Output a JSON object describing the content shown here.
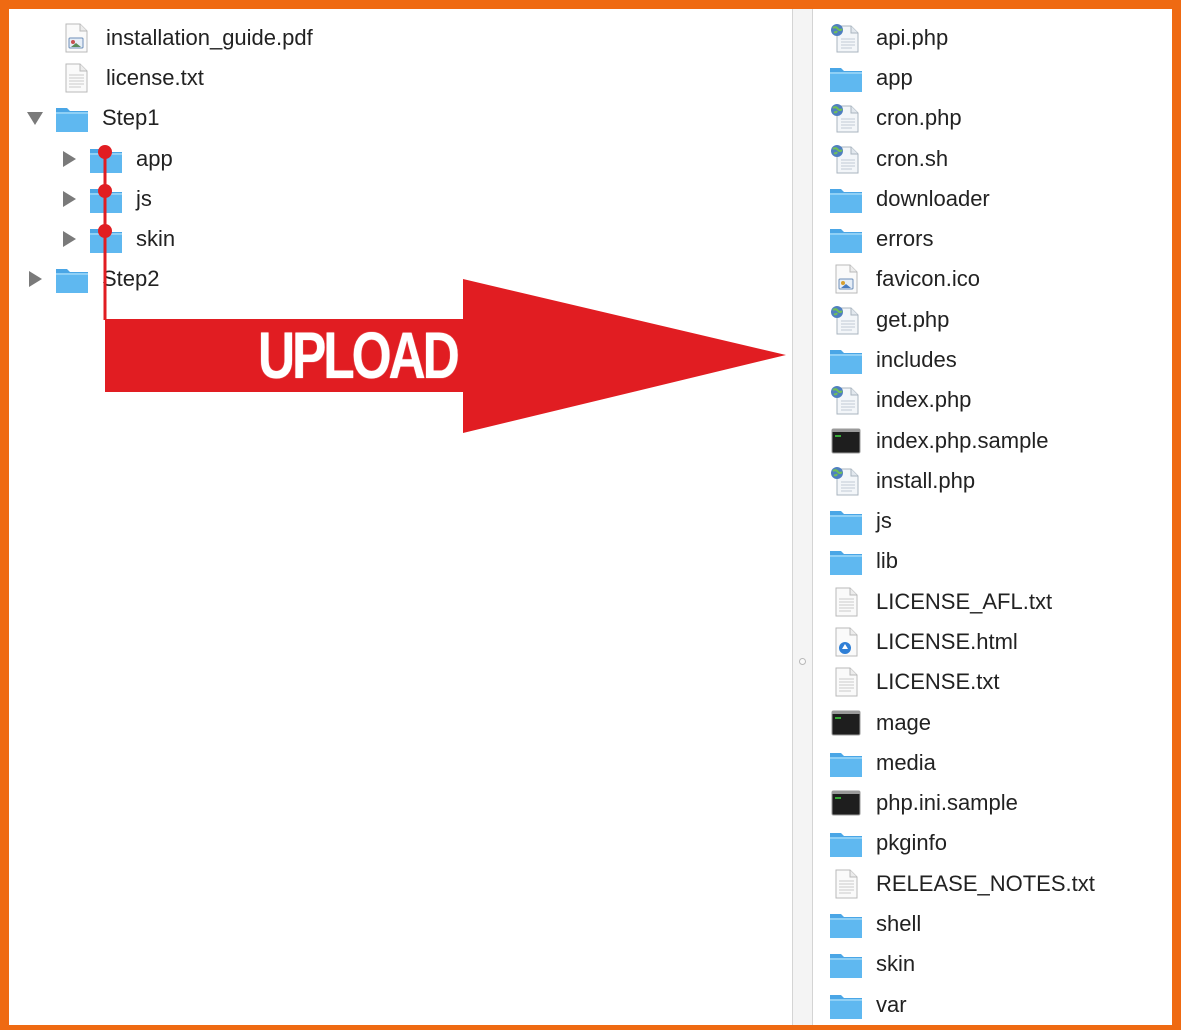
{
  "colors": {
    "frame": "#ef6a12",
    "arrow": "#e11d22",
    "folder": "#5fb8f0",
    "connector": "#e11d22"
  },
  "local_tree": {
    "items": [
      {
        "label": "installation_guide.pdf",
        "icon": "pdf-file-icon",
        "expanded": null
      },
      {
        "label": "license.txt",
        "icon": "text-file-icon",
        "expanded": null
      },
      {
        "label": "Step1",
        "icon": "folder-icon",
        "expanded": true
      },
      {
        "label": "app",
        "icon": "folder-icon",
        "expanded": false
      },
      {
        "label": "js",
        "icon": "folder-icon",
        "expanded": false
      },
      {
        "label": "skin",
        "icon": "folder-icon",
        "expanded": false
      },
      {
        "label": "Step2",
        "icon": "folder-icon",
        "expanded": false
      }
    ]
  },
  "annotation": {
    "arrow_label": "UPLOAD"
  },
  "remote_list": {
    "items": [
      {
        "label": "api.php",
        "icon": "php-file-icon"
      },
      {
        "label": "app",
        "icon": "folder-icon"
      },
      {
        "label": "cron.php",
        "icon": "php-file-icon"
      },
      {
        "label": "cron.sh",
        "icon": "php-file-icon"
      },
      {
        "label": "downloader",
        "icon": "folder-icon"
      },
      {
        "label": "errors",
        "icon": "folder-icon"
      },
      {
        "label": "favicon.ico",
        "icon": "image-file-icon"
      },
      {
        "label": "get.php",
        "icon": "php-file-icon"
      },
      {
        "label": "includes",
        "icon": "folder-icon"
      },
      {
        "label": "index.php",
        "icon": "php-file-icon"
      },
      {
        "label": "index.php.sample",
        "icon": "terminal-file-icon"
      },
      {
        "label": "install.php",
        "icon": "php-file-icon"
      },
      {
        "label": "js",
        "icon": "folder-icon"
      },
      {
        "label": "lib",
        "icon": "folder-icon"
      },
      {
        "label": "LICENSE_AFL.txt",
        "icon": "text-file-icon"
      },
      {
        "label": "LICENSE.html",
        "icon": "html-file-icon"
      },
      {
        "label": "LICENSE.txt",
        "icon": "text-file-icon"
      },
      {
        "label": "mage",
        "icon": "terminal-file-icon"
      },
      {
        "label": "media",
        "icon": "folder-icon"
      },
      {
        "label": "php.ini.sample",
        "icon": "terminal-file-icon"
      },
      {
        "label": "pkginfo",
        "icon": "folder-icon"
      },
      {
        "label": "RELEASE_NOTES.txt",
        "icon": "text-file-icon"
      },
      {
        "label": "shell",
        "icon": "folder-icon"
      },
      {
        "label": "skin",
        "icon": "folder-icon"
      },
      {
        "label": "var",
        "icon": "folder-icon"
      }
    ]
  }
}
